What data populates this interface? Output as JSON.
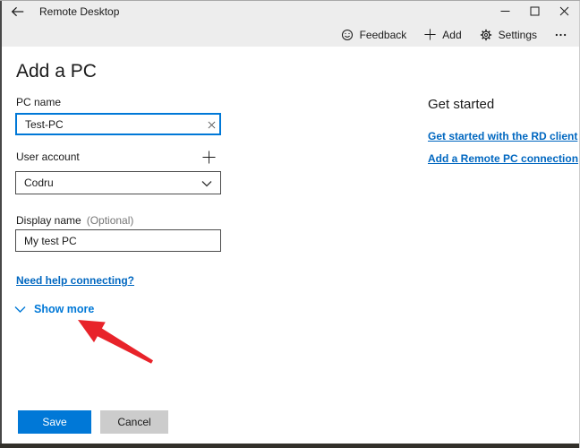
{
  "colors": {
    "accent": "#0078d7",
    "link": "#0067c0",
    "arrow_red": "#e8232a",
    "titlebar_bg": "#ededed",
    "save_bg": "#0078d7",
    "cancel_bg": "#cccccc"
  },
  "titlebar": {
    "title": "Remote Desktop",
    "back_icon": "arrow-left",
    "minimize_icon": "dash",
    "maximize_icon": "square",
    "close_icon": "x"
  },
  "toolbar": {
    "feedback_icon": "smiley",
    "feedback_label": "Feedback",
    "add_icon": "plus",
    "add_label": "Add",
    "settings_icon": "gear",
    "settings_label": "Settings",
    "more_icon": "ellipsis"
  },
  "page": {
    "title": "Add a PC"
  },
  "form": {
    "pc_name": {
      "label": "PC name",
      "value": "Test-PC",
      "clear_icon": "x"
    },
    "user_account": {
      "label": "User account",
      "value": "Codru",
      "add_icon": "plus",
      "dropdown_icon": "chevron-down"
    },
    "display_name": {
      "label": "Display name",
      "optional_hint": "(Optional)",
      "value": "My test PC"
    },
    "help_link_label": "Need help connecting?",
    "show_more_label": "Show more",
    "show_more_icon": "chevron-down"
  },
  "get_started": {
    "title": "Get started",
    "links": [
      {
        "label": "Get started with the RD client"
      },
      {
        "label": "Add a Remote PC connection"
      }
    ]
  },
  "actions": {
    "save_label": "Save",
    "cancel_label": "Cancel"
  },
  "annotation": {
    "arrow_icon": "red-arrow-pointing-to-show-more"
  }
}
